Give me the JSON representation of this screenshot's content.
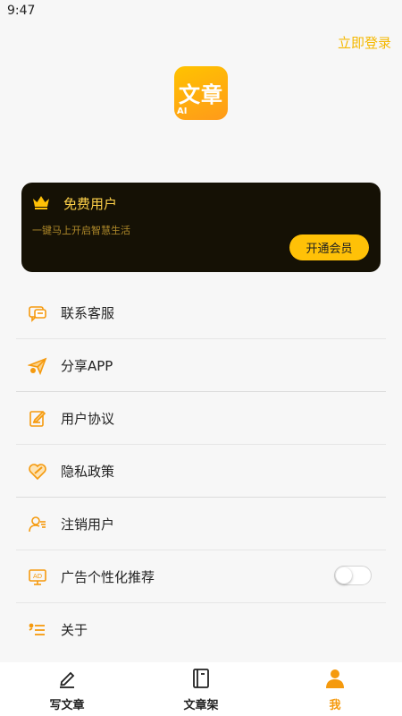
{
  "status_bar": {
    "time": "9:47"
  },
  "header": {
    "login_label": "立即登录"
  },
  "logo": {
    "text": "文章",
    "badge": "AI"
  },
  "member_card": {
    "title": "免费用户",
    "subtitle": "一键马上开启智慧生活",
    "button_label": "开通会员"
  },
  "menu": {
    "items": [
      {
        "label": "联系客服",
        "icon": "customer-service-icon"
      },
      {
        "label": "分享APP",
        "icon": "share-icon"
      },
      {
        "label": "用户协议",
        "icon": "agreement-icon"
      },
      {
        "label": "隐私政策",
        "icon": "privacy-icon"
      },
      {
        "label": "注销用户",
        "icon": "delete-user-icon"
      },
      {
        "label": "广告个性化推荐",
        "icon": "ad-icon",
        "toggle_on": false
      },
      {
        "label": "关于",
        "icon": "about-icon"
      }
    ]
  },
  "tab_bar": {
    "tabs": [
      {
        "label": "写文章",
        "icon": "pen-icon"
      },
      {
        "label": "文章架",
        "icon": "book-icon"
      },
      {
        "label": "我",
        "icon": "user-icon",
        "active": true
      }
    ]
  },
  "colors": {
    "accent": "#ffc107",
    "icon_orange": "#f59a0e",
    "card_bg": "#151105",
    "card_title": "#ffd24a"
  }
}
